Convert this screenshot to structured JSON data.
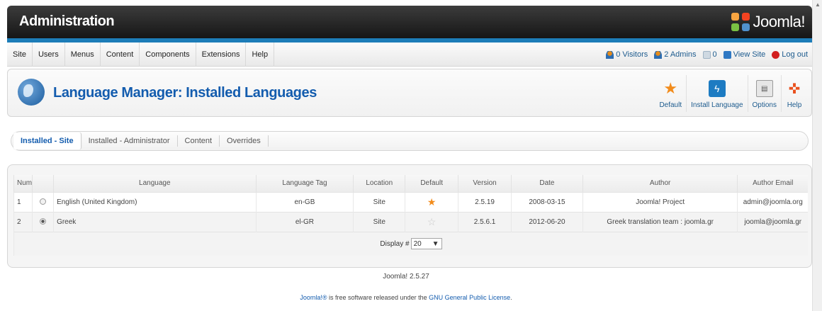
{
  "app": {
    "title": "Administration",
    "logo_text": "Joomla!",
    "accent_color": "#1d7db8",
    "title_color": "#135cae"
  },
  "menu": [
    "Site",
    "Users",
    "Menus",
    "Content",
    "Components",
    "Extensions",
    "Help"
  ],
  "status": {
    "visitors": "0 Visitors",
    "admins": "2 Admins",
    "messages": "0",
    "view_site": "View Site",
    "logout": "Log out"
  },
  "page": {
    "title": "Language Manager: Installed Languages"
  },
  "toolbar": {
    "default_label": "Default",
    "install_label": "Install Language",
    "options_label": "Options",
    "help_label": "Help"
  },
  "tabs": [
    {
      "label": "Installed - Site",
      "active": true
    },
    {
      "label": "Installed - Administrator",
      "active": false
    },
    {
      "label": "Content",
      "active": false
    },
    {
      "label": "Overrides",
      "active": false
    }
  ],
  "table": {
    "columns": [
      "Num",
      "Language",
      "Language Tag",
      "Location",
      "Default",
      "Version",
      "Date",
      "Author",
      "Author Email"
    ],
    "rows": [
      {
        "num": "1",
        "selected": false,
        "language": "English (United Kingdom)",
        "tag": "en-GB",
        "location": "Site",
        "is_default": true,
        "version": "2.5.19",
        "date": "2008-03-15",
        "author": "Joomla! Project",
        "email": "admin@joomla.org"
      },
      {
        "num": "2",
        "selected": true,
        "language": "Greek",
        "tag": "el-GR",
        "location": "Site",
        "is_default": false,
        "version": "2.5.6.1",
        "date": "2012-06-20",
        "author": "Greek translation team : joomla.gr",
        "email": "joomla@joomla.gr"
      }
    ],
    "display_label": "Display #",
    "display_value": "20"
  },
  "footer": {
    "version": "Joomla! 2.5.27",
    "license_pre": "is free software released under the",
    "license_brand": "Joomla!®",
    "license_link": "GNU General Public License",
    "license_post": "."
  }
}
